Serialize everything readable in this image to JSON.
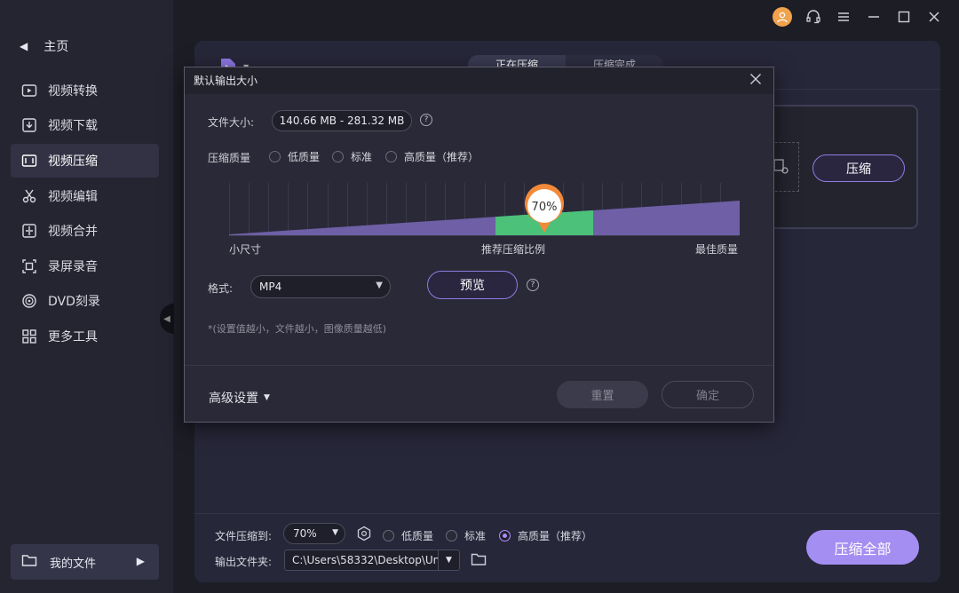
{
  "sidebar": {
    "home_label": "主页",
    "items": [
      {
        "label": "视频转换",
        "icon": "video-convert-icon"
      },
      {
        "label": "视频下载",
        "icon": "download-icon"
      },
      {
        "label": "视频压缩",
        "icon": "compress-icon"
      },
      {
        "label": "视频编辑",
        "icon": "scissors-icon"
      },
      {
        "label": "视频合并",
        "icon": "merge-icon"
      },
      {
        "label": "录屏录音",
        "icon": "record-icon"
      },
      {
        "label": "DVD刻录",
        "icon": "disc-icon"
      },
      {
        "label": "更多工具",
        "icon": "grid-icon"
      }
    ],
    "active_index": 2,
    "my_files_label": "我的文件"
  },
  "main": {
    "tabs": [
      "正在压缩",
      "压缩完成"
    ],
    "compress_button": "压缩"
  },
  "bottom": {
    "compress_to_label": "文件压缩到:",
    "compress_to_value": "70%",
    "quality_options": [
      "低质量",
      "标准",
      "高质量（推荐）"
    ],
    "quality_selected": 2,
    "output_folder_label": "输出文件夹:",
    "output_folder_value": "C:\\Users\\58332\\Desktop\\Un",
    "compress_all_button": "压缩全部"
  },
  "dialog": {
    "title": "默认输出大小",
    "file_size_label": "文件大小:",
    "file_size_value": "140.66 MB - 281.32 MB",
    "quality_label": "压缩质量",
    "quality_options": [
      "低质量",
      "标准",
      "高质量（推荐）"
    ],
    "slider": {
      "value_percent": 70,
      "value_label": "70%",
      "left_label": "小尺寸",
      "middle_label": "推荐压缩比例",
      "right_label": "最佳质量"
    },
    "format_label": "格式:",
    "format_value": "MP4",
    "preview_button": "预览",
    "hint": "*(设置值越小，文件越小，图像质量越低)",
    "advanced_label": "高级设置",
    "reset_button": "重置",
    "ok_button": "确定"
  },
  "colors": {
    "accent": "#a58ef2",
    "recommended_band": "#4cc17a",
    "avatar": "#f0a24c"
  }
}
